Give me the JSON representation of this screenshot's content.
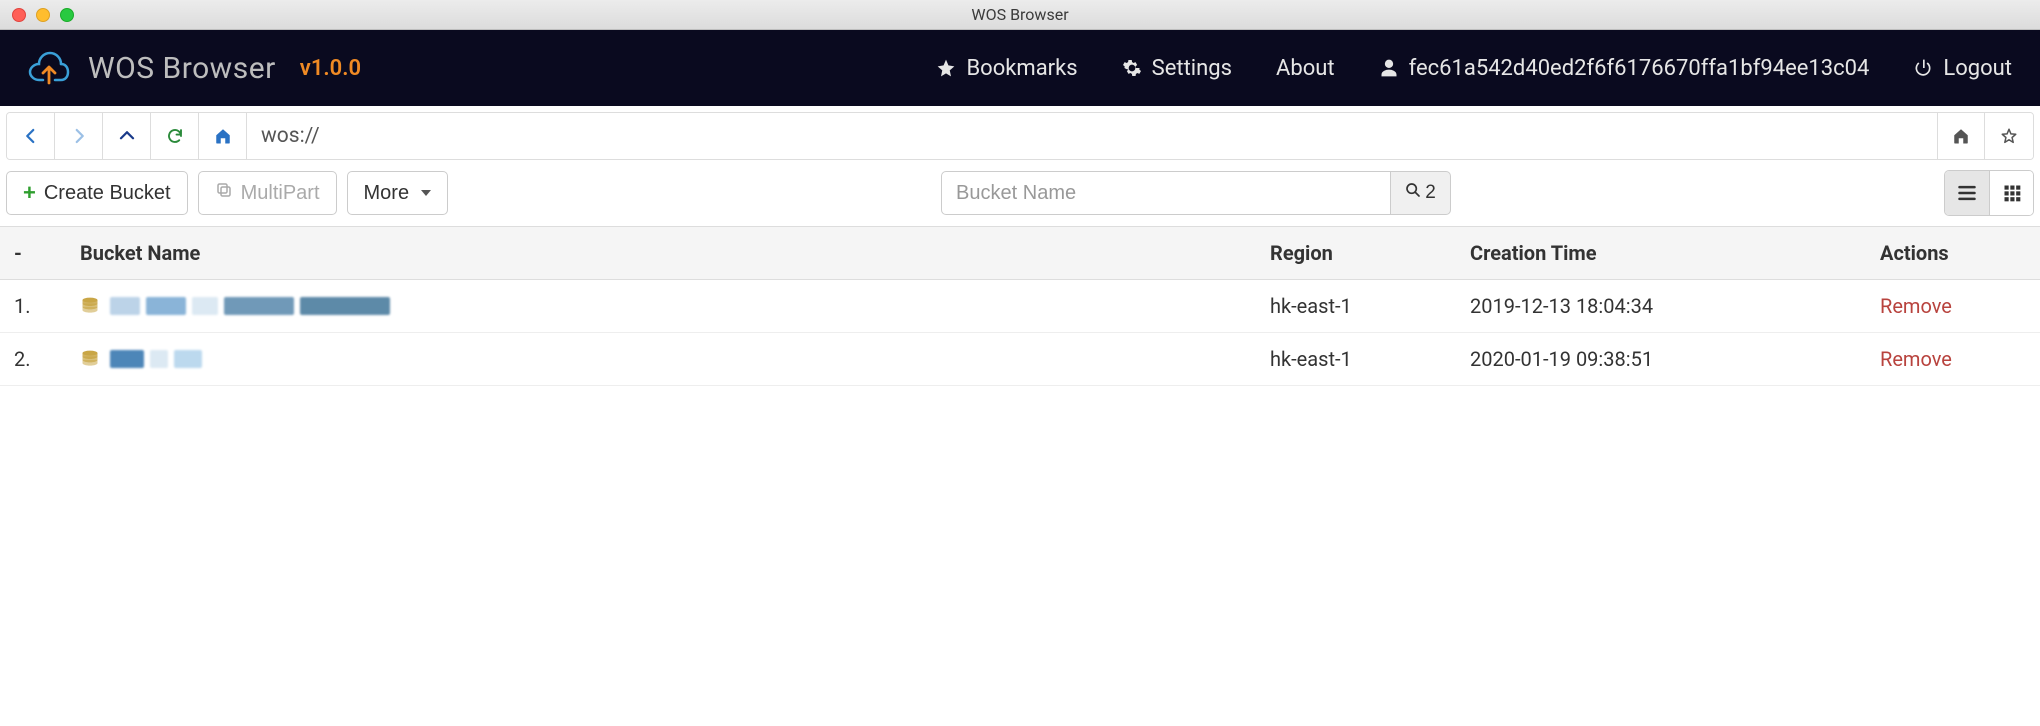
{
  "window": {
    "title": "WOS Browser"
  },
  "navbar": {
    "title": "WOS Browser",
    "version": "v1.0.0",
    "bookmarks": "Bookmarks",
    "settings": "Settings",
    "about": "About",
    "user_id": "fec61a542d40ed2f6f6176670ffa1bf94ee13c04",
    "logout": "Logout"
  },
  "address": {
    "value": "wos://"
  },
  "toolbar": {
    "create_bucket": "Create Bucket",
    "multipart": "MultiPart",
    "more": "More",
    "search_placeholder": "Bucket Name",
    "search_count": "2"
  },
  "table": {
    "headers": {
      "index": "-",
      "name": "Bucket Name",
      "region": "Region",
      "time": "Creation Time",
      "actions": "Actions"
    },
    "rows": [
      {
        "index": "1.",
        "name": "",
        "region": "hk-east-1",
        "time": "2019-12-13 18:04:34",
        "action": "Remove"
      },
      {
        "index": "2.",
        "name": "",
        "region": "hk-east-1",
        "time": "2020-01-19 09:38:51",
        "action": "Remove"
      }
    ]
  }
}
